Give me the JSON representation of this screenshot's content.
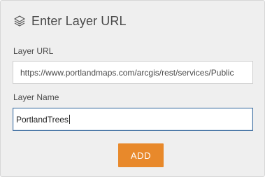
{
  "header": {
    "icon": "layers-icon",
    "title": "Enter Layer URL"
  },
  "layer_url": {
    "label": "Layer URL",
    "value": "https://www.portlandmaps.com/arcgis/rest/services/Public"
  },
  "layer_name": {
    "label": "Layer Name",
    "value": "PortlandTrees"
  },
  "add_button": {
    "label": "ADD",
    "color": "#e8892b"
  }
}
